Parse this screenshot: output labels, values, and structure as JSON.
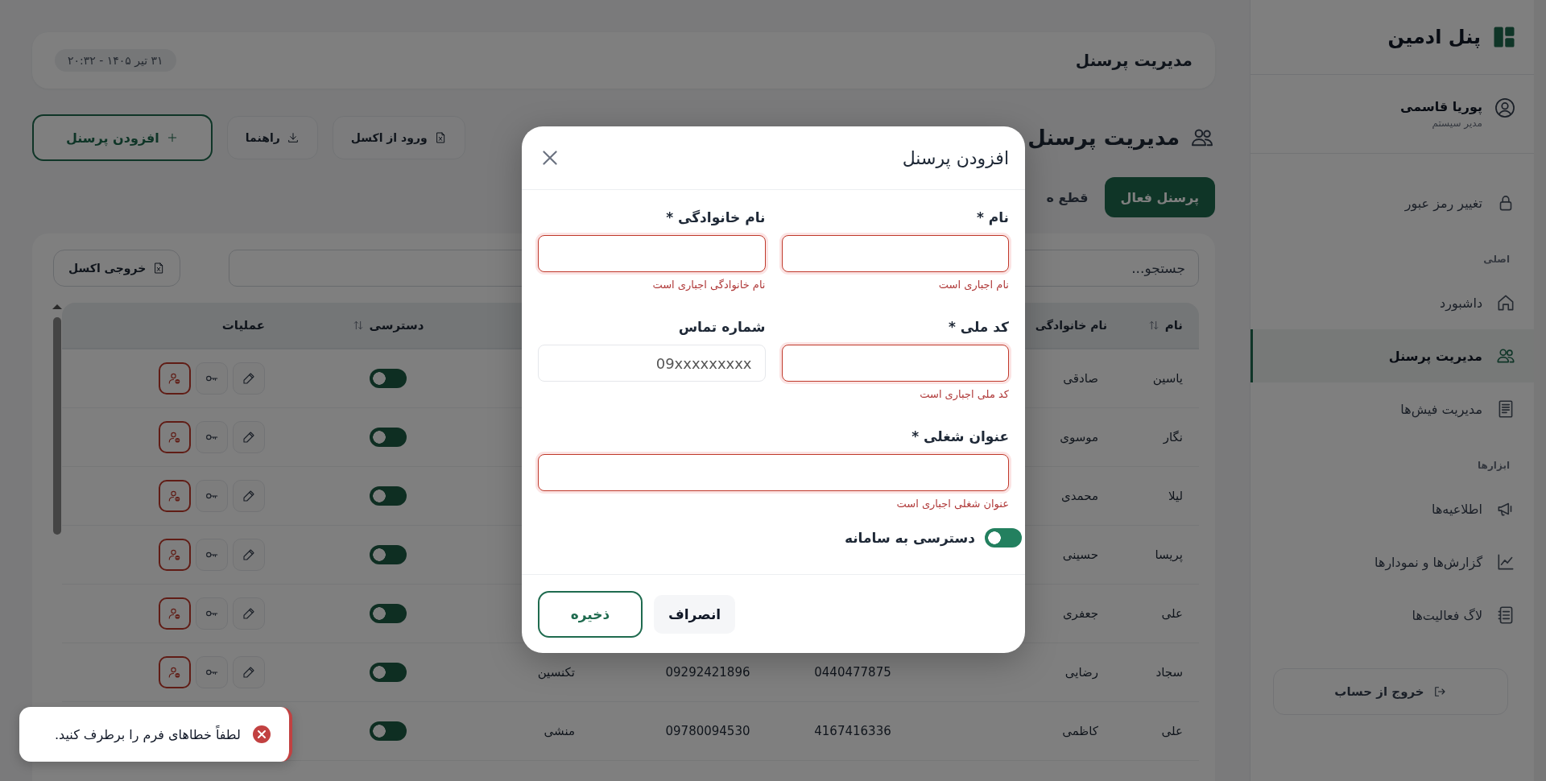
{
  "sidebar": {
    "brand": "پنل ادمین",
    "user": {
      "name": "پوریا قاسمی",
      "role": "مدیر سیستم"
    },
    "items": [
      {
        "label": "تغییر رمز عبور",
        "selected": false
      }
    ],
    "sections": [
      {
        "title": "اصلی",
        "items": [
          {
            "label": "داشبورد",
            "selected": false
          },
          {
            "label": "مدیریت پرسنل",
            "selected": true
          },
          {
            "label": "مدیریت فیش‌ها",
            "selected": false
          }
        ]
      },
      {
        "title": "ابزارها",
        "items": [
          {
            "label": "اطلاعیه‌ها",
            "selected": false
          },
          {
            "label": "گزارش‌ها و نمودارها",
            "selected": false
          },
          {
            "label": "لاگ فعالیت‌ها",
            "selected": false
          }
        ]
      }
    ],
    "logout": "خروج از حساب"
  },
  "header": {
    "title": "مدیریت پرسنل",
    "datetime": "۳۱ تیر ۱۴۰۵ - ۲۰:۳۲"
  },
  "page": {
    "title": "مدیریت پرسنل",
    "buttons": [
      {
        "label": "ورود از اکسل",
        "kind": "import"
      },
      {
        "label": "راهنما",
        "kind": "guide"
      },
      {
        "label": "افزودن پرسنل",
        "kind": "add"
      }
    ]
  },
  "tabs": [
    {
      "label": "پرسنل فعال",
      "selected": true
    },
    {
      "label": "قطع ه",
      "selected": false
    }
  ],
  "table": {
    "search": {
      "placeholder": "جستجو..."
    },
    "export": "خروجی اکسل",
    "columns": [
      {
        "kind": "name",
        "label": "نام",
        "sortable": true
      },
      {
        "kind": "family",
        "label": "نام خانوادگی",
        "sortable": false
      },
      {
        "kind": "access",
        "label": "دسترسی",
        "sortable": true
      },
      {
        "kind": "actions",
        "label": "عملیات",
        "sortable": false
      }
    ],
    "rows": [
      {
        "name": "یاسین",
        "family": "صادقی",
        "access": true,
        "actions": true
      },
      {
        "name": "نگار",
        "family": "موسوی",
        "access": true,
        "actions": true
      },
      {
        "name": "لیلا",
        "family": "محمدی",
        "access": true,
        "actions": true
      },
      {
        "name": "پریسا",
        "family": "حسینی",
        "access": true,
        "actions": true
      },
      {
        "name": "علی",
        "family": "جعفری",
        "access": true,
        "actions": true
      },
      {
        "name": "سجاد",
        "family": "رضایی",
        "national_code": "0440477875",
        "phone": "09292421896",
        "job": "تکنسین",
        "access": true,
        "actions": true
      },
      {
        "name": "علی",
        "family": "کاظمی",
        "national_code": "4167416336",
        "phone": "09780094530",
        "job": "منشی",
        "access": true,
        "actions": false
      }
    ]
  },
  "modal": {
    "title": "افزودن پرسنل",
    "fields": [
      {
        "label": "نام *",
        "error": "نام اجباری است",
        "kind": "half"
      },
      {
        "label": "نام خانوادگی *",
        "error": "نام خانوادگی اجباری است",
        "kind": "half"
      },
      {
        "label": "کد ملی *",
        "error": "کد ملی اجباری است",
        "kind": "half"
      },
      {
        "label": "شماره تماس",
        "placeholder": "09xxxxxxxxx",
        "kind": "half"
      },
      {
        "label": "عنوان شغلی *",
        "error": "عنوان شغلی اجباری است",
        "kind": "full"
      }
    ],
    "toggle": {
      "label": "دسترسی به سامانه",
      "on": true
    },
    "buttons": [
      {
        "label": "انصراف",
        "kind": "secondary"
      },
      {
        "label": "ذخیره",
        "kind": "primary"
      }
    ]
  },
  "toast": {
    "message": "لطفاً خطاهای فرم را برطرف کنید.",
    "kind": "error"
  }
}
